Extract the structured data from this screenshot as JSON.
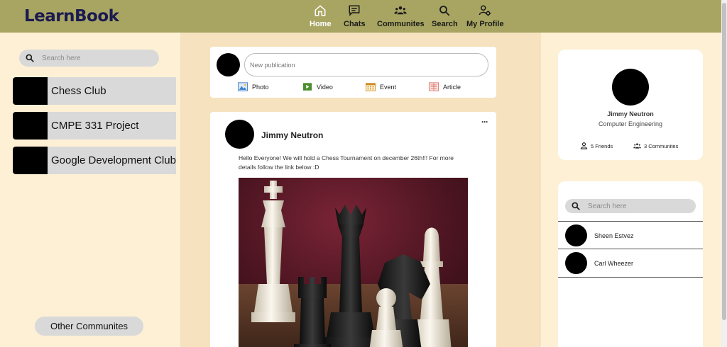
{
  "app": {
    "logo": "LearnBook"
  },
  "nav": [
    {
      "label": "Home",
      "icon": "home-icon",
      "active": true
    },
    {
      "label": "Chats",
      "icon": "chat-icon"
    },
    {
      "label": "Communites",
      "icon": "communities-icon"
    },
    {
      "label": "Search",
      "icon": "search-icon"
    },
    {
      "label": "My Profile",
      "icon": "profile-settings-icon"
    }
  ],
  "left_sidebar": {
    "search_placeholder": "Search here",
    "communities": [
      {
        "name": "Chess Club"
      },
      {
        "name": "CMPE 331 Project"
      },
      {
        "name": "Google Development Club"
      }
    ],
    "other_button": "Other Communites"
  },
  "composer": {
    "placeholder": "New publication",
    "actions": [
      {
        "label": "Photo",
        "icon": "photo-icon"
      },
      {
        "label": "Video",
        "icon": "video-icon"
      },
      {
        "label": "Event",
        "icon": "calendar-icon"
      },
      {
        "label": "Article",
        "icon": "article-icon"
      }
    ]
  },
  "post": {
    "author": "Jimmy Neutron",
    "more": "···",
    "text": "Hello Everyone! We will hold a Chess Tournament on december 26th!!! For more details follow the link below :D",
    "image": "chess-pieces-image"
  },
  "profile": {
    "name": "Jimmy Neutron",
    "department": "Computer Engineering",
    "friends": "5 Friends",
    "communities": "3 Communites"
  },
  "friends_panel": {
    "search_placeholder": "Search here",
    "friends": [
      {
        "name": "Sheen Estvez"
      },
      {
        "name": "Carl Wheezer"
      }
    ]
  },
  "colors": {
    "header": "#a8a562",
    "logo": "#1a1a52",
    "side_background": "#fdf0d5",
    "feed_background": "#f7e2bf",
    "pill": "#d9d9d9"
  }
}
